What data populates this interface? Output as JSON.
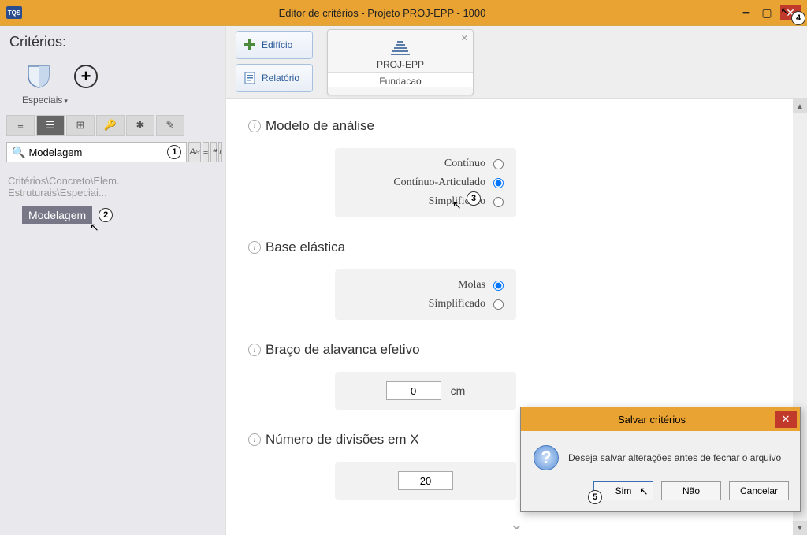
{
  "titlebar": {
    "title": "Editor de critérios - Projeto PROJ-EPP - 1000",
    "app": "TQS"
  },
  "sidebar": {
    "header": "Critérios:",
    "especiais": "Especiais",
    "search_value": "Modelagem",
    "search_opts": {
      "aa": "Aa",
      "eq": "≡",
      "quote": "❝",
      "i": "i"
    },
    "breadcrumb": "Critérios\\Concreto\\Elem. Estruturais\\Especiai...",
    "tree_item": "Modelagem"
  },
  "tabs": {
    "edificio": "Edifício",
    "relatorio": "Relatório",
    "project": "PROJ-EPP",
    "subproject": "Fundacao"
  },
  "sections": {
    "modelo": {
      "title": "Modelo de análise",
      "opts": [
        "Contínuo",
        "Contínuo-Articulado",
        "Simplificado"
      ]
    },
    "base": {
      "title": "Base elástica",
      "opts": [
        "Molas",
        "Simplificado"
      ]
    },
    "braco": {
      "title": "Braço de alavanca efetivo",
      "value": "0",
      "unit": "cm"
    },
    "divx": {
      "title": "Número de divisões em X",
      "value": "20"
    }
  },
  "dialog": {
    "title": "Salvar critérios",
    "message": "Deseja salvar alterações antes de fechar o arquivo",
    "sim": "Sim",
    "nao": "Não",
    "cancelar": "Cancelar"
  },
  "badges": {
    "b1": "1",
    "b2": "2",
    "b3": "3",
    "b4": "4",
    "b5": "5"
  }
}
